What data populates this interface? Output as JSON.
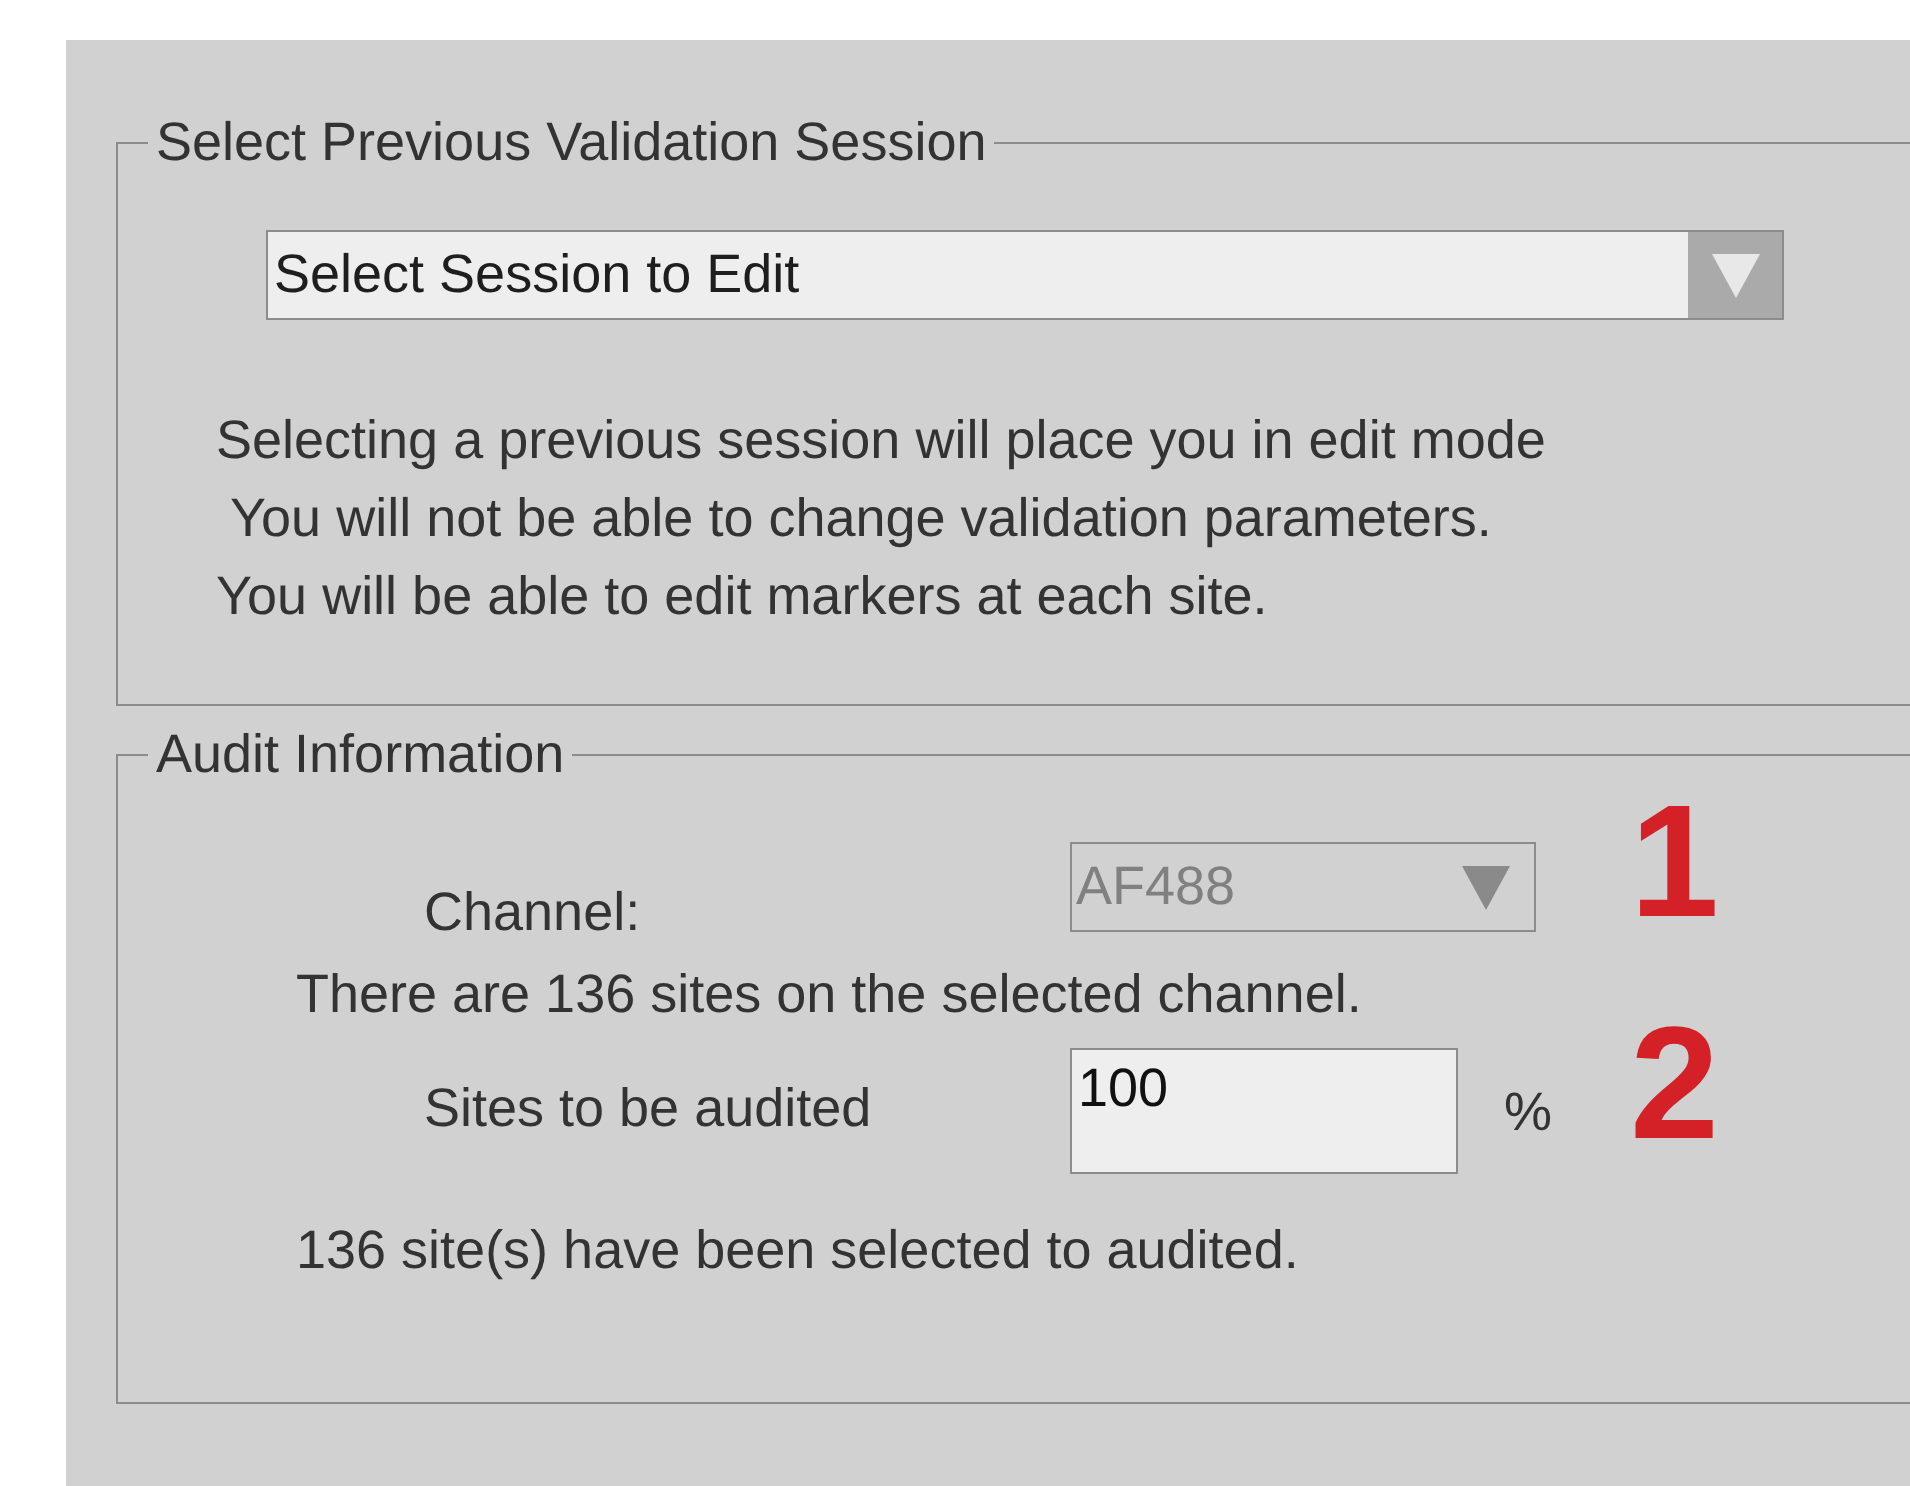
{
  "session_group": {
    "title": "Select Previous Validation Session",
    "dropdown": {
      "value": "Select Session to Edit",
      "disabled": false
    },
    "notes": [
      "Selecting a previous session will place you in edit mode",
      " You will not be able to change validation parameters.",
      "You will be able to edit markers at each site."
    ]
  },
  "audit_group": {
    "title": "Audit Information",
    "channel": {
      "label": "Channel:",
      "value": "AF488",
      "disabled": true,
      "annotation": "1"
    },
    "sites_info": "There are 136 sites on the selected channel.",
    "sites_to_audit": {
      "label": "Sites to be audited",
      "value": "100",
      "unit": "%",
      "annotation": "2"
    },
    "selected_info": "136 site(s) have been selected to audited."
  }
}
